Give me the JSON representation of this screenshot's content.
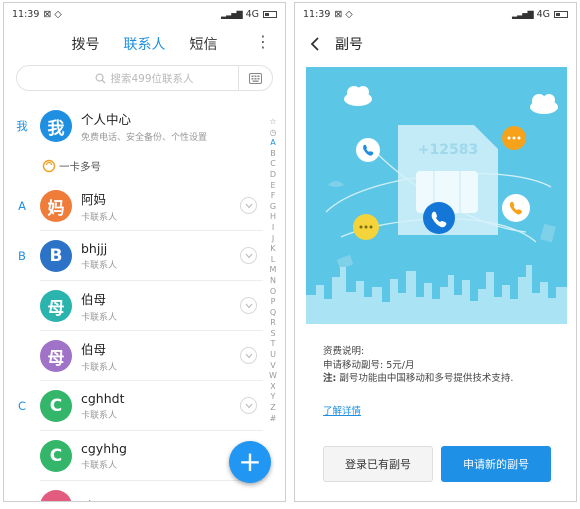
{
  "status_left": {
    "time": "11:39",
    "icons": "⊠ ◇"
  },
  "status_right": {
    "time": "11:39",
    "icons": "⊠ ◇"
  },
  "status_net": "4G",
  "tabs": [
    {
      "label": "拨号"
    },
    {
      "label": "联系人"
    },
    {
      "label": "短信"
    }
  ],
  "menu_glyph": "⋮",
  "search": {
    "placeholder": "搜索499位联系人"
  },
  "me": {
    "letter": "我",
    "avatar_char": "我",
    "name": "个人中心",
    "sub": "免费电话、安全备份、个性设置",
    "color": "#1e8fe1"
  },
  "multi_number": {
    "label": "一卡多号"
  },
  "contacts": [
    {
      "letter": "A",
      "avatar_char": "妈",
      "name": "阿妈",
      "sub": "卡联系人",
      "color": "#f07c3a",
      "chevron": true
    },
    {
      "letter": "B",
      "avatar_char": "B",
      "name": "bhjjj",
      "sub": "卡联系人",
      "color": "#2c72c7",
      "chevron": true
    },
    {
      "letter": "",
      "avatar_char": "母",
      "name": "伯母",
      "sub": "卡联系人",
      "color": "#2bb3ae",
      "chevron": true
    },
    {
      "letter": "",
      "avatar_char": "母",
      "name": "伯母",
      "sub": "卡联系人",
      "color": "#a072c8",
      "chevron": true
    },
    {
      "letter": "C",
      "avatar_char": "C",
      "name": "cghhdt",
      "sub": "卡联系人",
      "color": "#33b56a",
      "chevron": true
    },
    {
      "letter": "",
      "avatar_char": "C",
      "name": "cgyhhg",
      "sub": "卡联系人",
      "color": "#33b56a",
      "chevron": false
    },
    {
      "letter": "",
      "avatar_char": "",
      "name": "cj",
      "sub": "",
      "color": "#e25c80",
      "chevron": false
    }
  ],
  "alphabet": [
    "☆",
    "◷",
    "A",
    "B",
    "C",
    "D",
    "E",
    "F",
    "G",
    "H",
    "I",
    "J",
    "K",
    "L",
    "M",
    "N",
    "O",
    "P",
    "Q",
    "R",
    "S",
    "T",
    "U",
    "V",
    "W",
    "X",
    "Y",
    "Z",
    "#"
  ],
  "alphabet_active": "A",
  "fab_label": "+",
  "fab_icon": "plus-icon",
  "detail": {
    "title": "副号",
    "sim_number": "+12583",
    "fee_title": "资费说明:",
    "fee_line": "申请移动副号: 5元/月",
    "note_label": "注:",
    "note_text": " 副号功能由中国移动和多号提供技术支持.",
    "link": "了解详情",
    "btn_login": "登录已有副号",
    "btn_apply": "申请新的副号"
  },
  "colors": {
    "accent": "#1e8fe1",
    "banner": "#5bc6e6",
    "orange_bubble": "#f7a21b",
    "yellow_bubble": "#f4d43a"
  }
}
